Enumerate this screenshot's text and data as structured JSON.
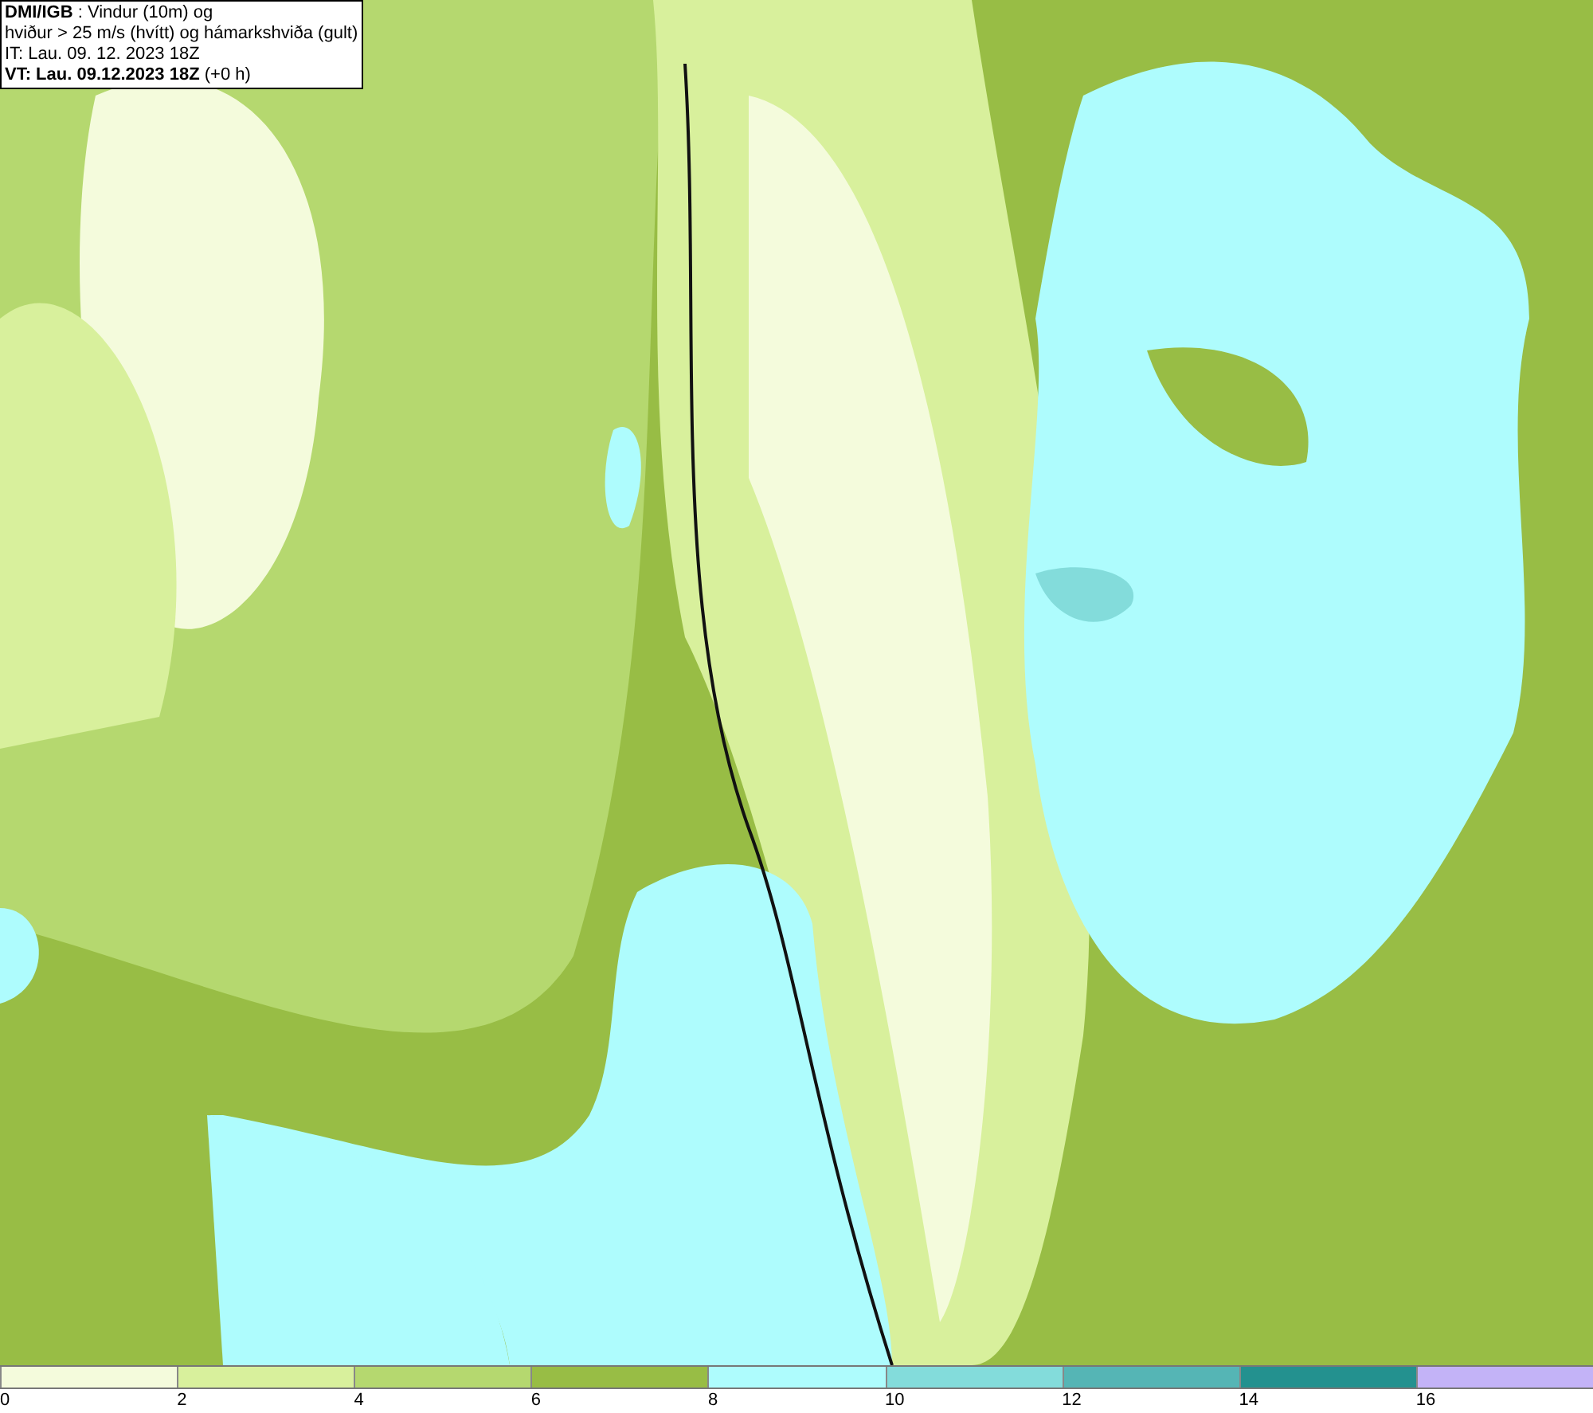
{
  "title_box": {
    "lines": [
      "**DMI/IGB** : Vindur (10m) og",
      "hviður > 25 m/s (hvítt) og hámarkshviða (gult)",
      "IT: Lau. 09. 12. 2023 18Z",
      "**VT: Lau. 09.12.2023 18Z** (+0 h)"
    ]
  },
  "legend": {
    "bins": [
      {
        "color": "#f4fbdc"
      },
      {
        "color": "#d8f09c"
      },
      {
        "color": "#b5d86f"
      },
      {
        "color": "#98bd45"
      },
      {
        "color": "#aefcfd"
      },
      {
        "color": "#83dcdb"
      },
      {
        "color": "#55b5b5"
      },
      {
        "color": "#23918f"
      },
      {
        "color": "#c3b3f7"
      }
    ],
    "ticks": [
      "0",
      "2",
      "4",
      "6",
      "8",
      "10",
      "12",
      "14",
      "16"
    ]
  }
}
